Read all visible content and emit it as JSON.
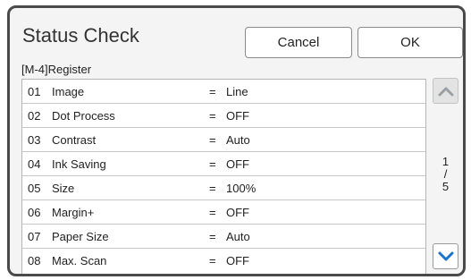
{
  "header": {
    "title": "Status Check",
    "cancel_label": "Cancel",
    "ok_label": "OK"
  },
  "section_title": "[M-4]Register",
  "rows": [
    {
      "num": "01",
      "name": "Image",
      "eq": "=",
      "value": "Line"
    },
    {
      "num": "02",
      "name": "Dot Process",
      "eq": "=",
      "value": "OFF"
    },
    {
      "num": "03",
      "name": "Contrast",
      "eq": "=",
      "value": "Auto"
    },
    {
      "num": "04",
      "name": "Ink Saving",
      "eq": "=",
      "value": "OFF"
    },
    {
      "num": "05",
      "name": "Size",
      "eq": "=",
      "value": "100%"
    },
    {
      "num": "06",
      "name": "Margin+",
      "eq": "=",
      "value": "OFF"
    },
    {
      "num": "07",
      "name": "Paper Size",
      "eq": "=",
      "value": "Auto"
    },
    {
      "num": "08",
      "name": "Max. Scan",
      "eq": "=",
      "value": "OFF"
    }
  ],
  "pager": {
    "current": "1",
    "separator": "/",
    "total": "5"
  },
  "icons": {
    "up": "chevron-up-icon",
    "down": "chevron-down-icon"
  },
  "colors": {
    "accent": "#1a73c8",
    "disabled": "#9aa0a6"
  }
}
